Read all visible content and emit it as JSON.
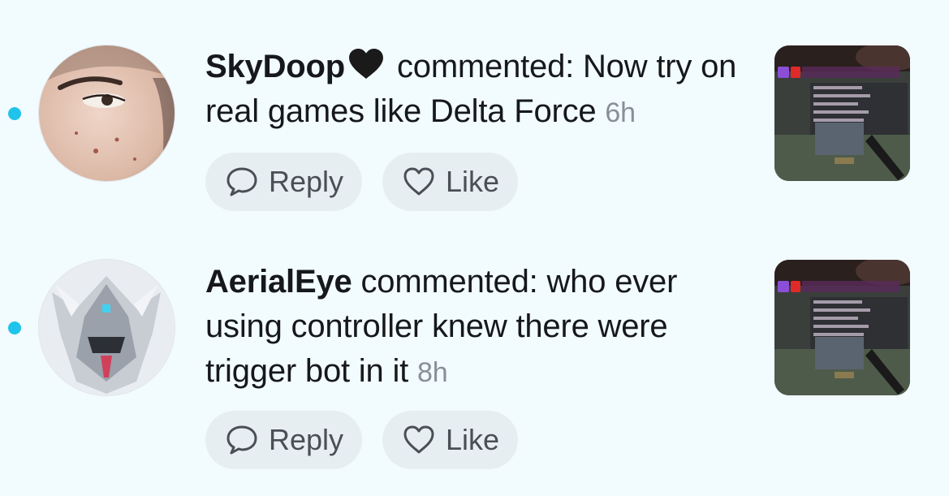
{
  "colors": {
    "background": "#f2fbfe",
    "unread_dot": "#20c4ea",
    "button_bg": "#e6eef1",
    "time_text": "#8a8f96"
  },
  "comments": [
    {
      "username": "SkyDoop",
      "emoji": "black-heart",
      "action": "commented:",
      "text": "Now try on real games like Delta Force",
      "time": "6h",
      "reply_label": "Reply",
      "like_label": "Like"
    },
    {
      "username": "AerialEye",
      "action": "commented:",
      "text": "who ever using controller knew there were trigger bot in it",
      "time": "8h",
      "reply_label": "Reply",
      "like_label": "Like"
    }
  ]
}
